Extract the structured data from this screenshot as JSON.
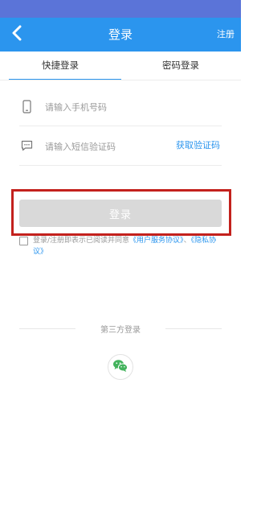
{
  "header": {
    "title": "登录",
    "register_label": "注册",
    "back_icon": "chevron-left-icon",
    "color": "#2b95ee",
    "status_bar_color": "#5b74d8"
  },
  "tabs": {
    "items": [
      {
        "label": "快捷登录",
        "active": true
      },
      {
        "label": "密码登录",
        "active": false
      }
    ]
  },
  "form": {
    "phone": {
      "value": "",
      "placeholder": "请输入手机号码",
      "icon": "phone-icon"
    },
    "sms_code": {
      "value": "",
      "placeholder": "请输入短信验证码",
      "icon": "message-icon"
    },
    "get_code_label": "获取验证码"
  },
  "login_button": {
    "label": "登录",
    "enabled": false,
    "highlight_color": "#c3211d"
  },
  "agreement": {
    "checked": false,
    "prefix": "登录/注册即表示已阅读并同意",
    "service_link": "《用户服务协议》",
    "separator": "、",
    "privacy_link": "《隐私协议》"
  },
  "third_party": {
    "label": "第三方登录",
    "providers": [
      {
        "icon": "wechat-icon"
      }
    ]
  }
}
